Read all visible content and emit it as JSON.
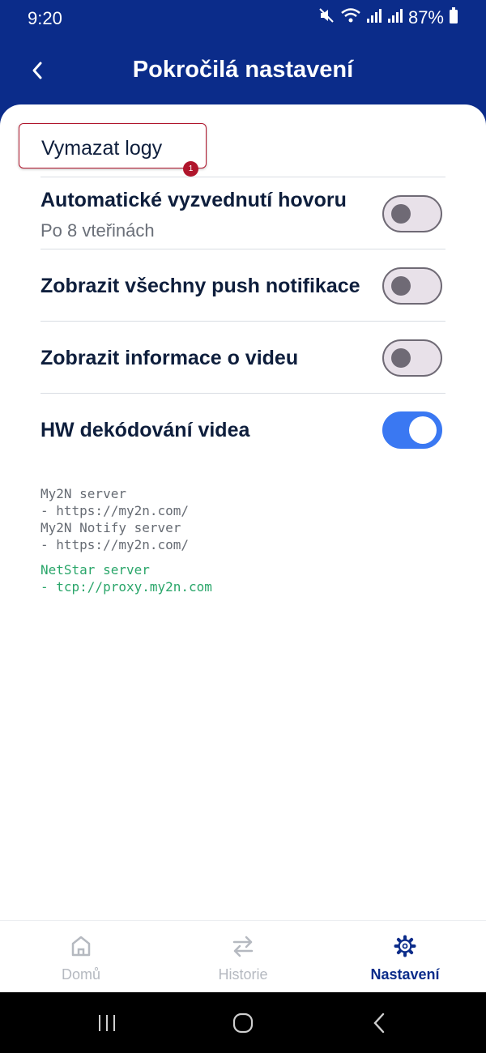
{
  "status_bar": {
    "time": "9:20",
    "battery": "87%"
  },
  "header": {
    "title": "Pokročilá nastavení"
  },
  "clear_logs": {
    "label": "Vymazat logy",
    "badge": "1"
  },
  "settings": [
    {
      "title": "Automatické vyzvednutí hovoru",
      "subtitle": "Po 8 vteřinách",
      "enabled": false
    },
    {
      "title": "Zobrazit všechny push notifikace",
      "enabled": false
    },
    {
      "title": "Zobrazit informace o videu",
      "enabled": false
    },
    {
      "title": "HW dekódování videa",
      "enabled": true
    }
  ],
  "server_info": {
    "my2n_label": "My2N server",
    "my2n_url": "- https://my2n.com/",
    "notify_label": "My2N Notify server",
    "notify_url": "- https://my2n.com/",
    "netstar_label": "NetStar server",
    "netstar_url": "- tcp://proxy.my2n.com"
  },
  "bottom_nav": [
    {
      "label": "Domů",
      "icon": "home-icon",
      "active": false
    },
    {
      "label": "Historie",
      "icon": "swap-arrows-icon",
      "active": false
    },
    {
      "label": "Nastavení",
      "icon": "gear-icon",
      "active": true
    }
  ],
  "colors": {
    "header": "#0b2c8a",
    "accent": "#3a78f2",
    "badge": "#b0152c",
    "netstar": "#2aa66a"
  }
}
